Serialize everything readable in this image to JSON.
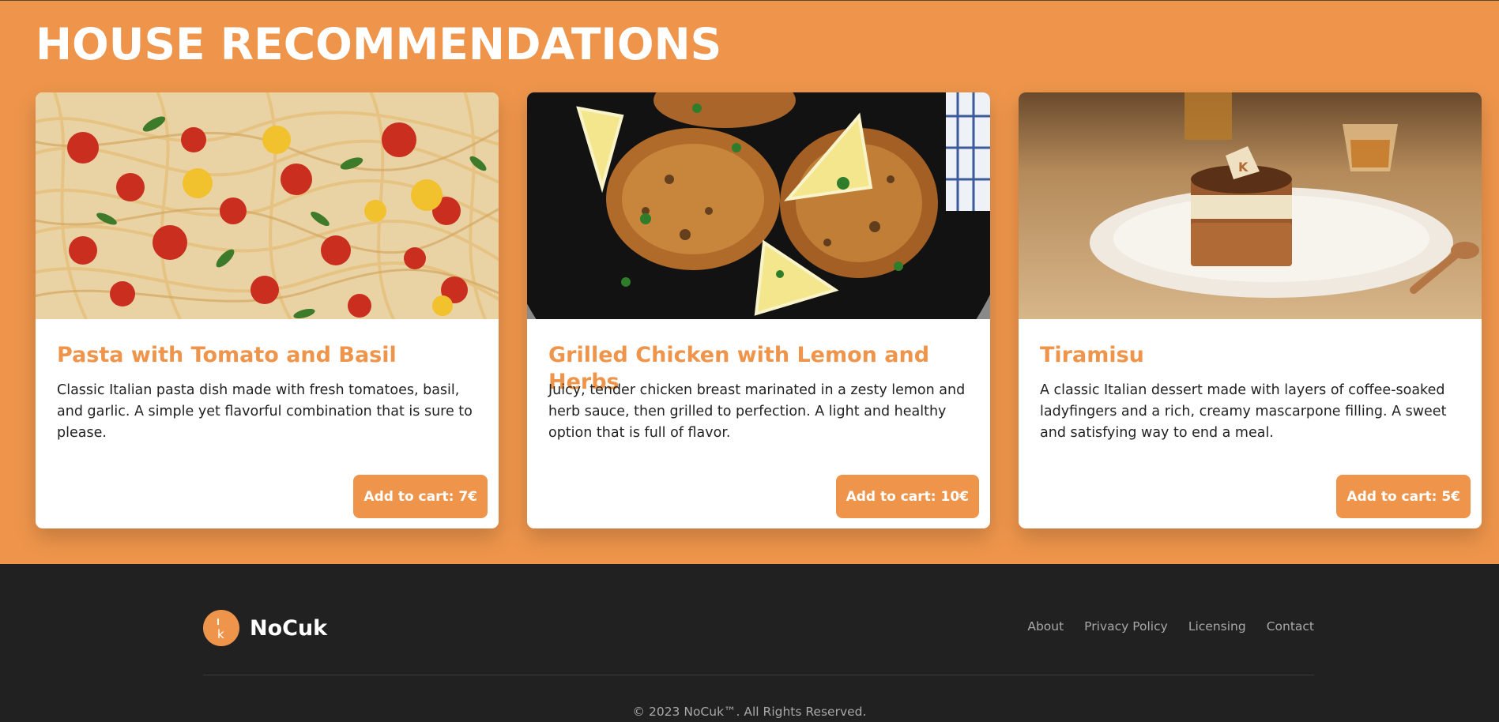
{
  "section": {
    "title": "HOUSE RECOMMENDATIONS",
    "background_color": "#ee954b"
  },
  "cards": [
    {
      "image": "pasta-photo",
      "title": "Pasta with Tomato and Basil",
      "description": "Classic Italian pasta dish made with fresh tomatoes, basil, and garlic. A simple yet flavorful combination that is sure to please.",
      "button": "Add to cart: 7€"
    },
    {
      "image": "grilled-chicken-photo",
      "title": "Grilled Chicken with Lemon and Herbs",
      "description": "Juicy, tender chicken breast marinated in a zesty lemon and herb sauce, then grilled to perfection. A light and healthy option that is full of flavor.",
      "button": "Add to cart: 10€"
    },
    {
      "image": "tiramisu-photo",
      "title": "Tiramisu",
      "description": "A classic Italian dessert made with layers of coffee-soaked ladyfingers and a rich, creamy mascarpone filling. A sweet and satisfying way to end a meal.",
      "button": "Add to cart: 5€"
    }
  ],
  "footer": {
    "brand_name": "NoCuk",
    "logo_icon": "chef-knife-logo",
    "nav": [
      "About",
      "Privacy Policy",
      "Licensing",
      "Contact"
    ],
    "copyright": "© 2023 NoCuk™. All Rights Reserved.",
    "background_color": "#212121"
  },
  "colors": {
    "accent": "#ee954b",
    "card_bg": "#ffffff",
    "footer_text": "#a8a8a8"
  }
}
